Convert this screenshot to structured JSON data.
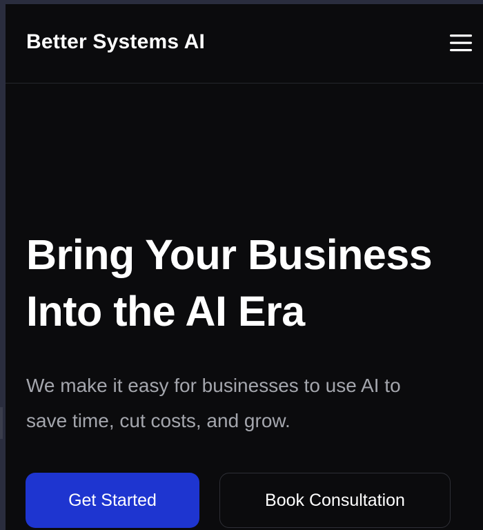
{
  "header": {
    "brand": "Better Systems AI",
    "menu_icon": "hamburger-menu-icon"
  },
  "hero": {
    "title_line1": "Bring Your Business",
    "title_line2": "Into the AI Era",
    "subtitle_line1": "We make it easy for businesses to use AI to",
    "subtitle_line2": "save time, cut costs, and grow."
  },
  "cta": {
    "primary_label": "Get Started",
    "secondary_label": "Book Consultation"
  },
  "colors": {
    "background": "#0b0b0d",
    "primary_button": "#1e35d0",
    "subtitle_text": "#a4a6ad",
    "divider": "#26272c"
  }
}
